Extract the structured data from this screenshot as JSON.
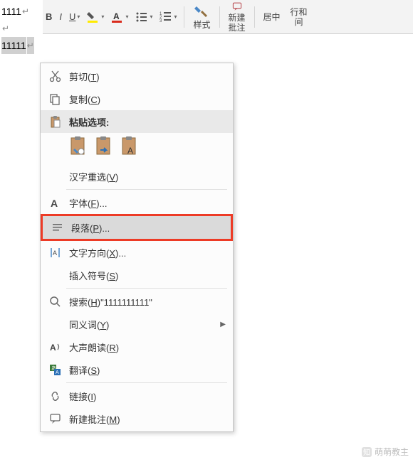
{
  "doc": {
    "line1": "1111",
    "line2": "11111"
  },
  "ribbon": {
    "bold": "B",
    "italic": "I",
    "underline": "U",
    "styles": "样式",
    "new_comment_l1": "新建",
    "new_comment_l2": "批注",
    "center": "居中",
    "line_spacing_l1": "行和",
    "line_spacing_l2": "间"
  },
  "menu": {
    "cut": "剪切(T)",
    "copy": "复制(C)",
    "paste_header": "粘贴选项:",
    "ime": "汉字重选(V)",
    "font": "字体(F)...",
    "paragraph": "段落(P)...",
    "text_dir": "文字方向(X)...",
    "symbol": "插入符号(S)",
    "search": "搜索(H)\"1111111111\"",
    "synonym": "同义词(Y)",
    "read_aloud": "大声朗读(R)",
    "translate": "翻译(S)",
    "link": "链接(I)",
    "new_comment": "新建批注(M)"
  },
  "watermark": "萌萌教主"
}
